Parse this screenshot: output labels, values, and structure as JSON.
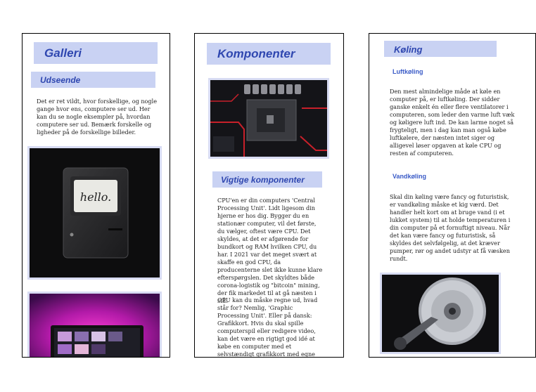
{
  "col1": {
    "title": "Galleri",
    "subtitle": "Udseende",
    "text": "Det er ret vildt, hvor forskellige, og nogle gange hvor ens, computere ser ud. Her kan du se nogle eksempler på, hvordan computere ser ud. Bemærk forskelle og ligheder på de forskellige billeder.",
    "image1_text": "hello."
  },
  "col2": {
    "title": "Komponenter",
    "subtitle": "Vigtige komponenter",
    "para1": "CPU'en er din computers 'Central Processing Unit'. Lidt ligesom din hjerne er hos dig. Bygger du en stationær computer, vil det første, du vælger, oftest være CPU. Det skyldes, at det er afgørende for bundkort og RAM hvilken CPU, du har. I 2021 var det meget svært at skaffe en god CPU, da producenterne slet ikke kunne klare efterspørgslen. Det skyldtes både corona-logistik og \"bitcoin\" mining, der fik markedet til at gå næsten i stå.",
    "para2": "GPU kan du måske regne ud, hvad står for? Nemlig, 'Graphic Processing Unit'. Eller på dansk: Grafikkort. Hvis du skal spille computerspil eller redigere video, kan det være en rigtigt god idé at købe en computer med et selvstændigt grafikkort med egne dedikerede RAM. Det er store kræfter"
  },
  "col3": {
    "title": "Køling",
    "sub1": "Luftkøling",
    "para1": "Den mest almindelige måde at køle en computer på, er luftkøling. Der sidder ganske enkelt én eller flere ventilatorer i computeren, som leder den varme luft væk og køligere luft ind. De kan larme noget så frygteligt, men i dag kan man også købe luftkølere, der næsten intet siger og alligevel løser opgaven at køle CPU og resten af computeren.",
    "sub2": "Vandkøling",
    "para2": "Skal din køling være fancy og futuristisk, er vandkøling måske et kig værd. Det handler helt kort om at bruge vand (i et lukket system) til at holde temperaturen i din computer på et fornuftigt niveau. Når det kan være fancy og futuristisk, så skyldes det selvfølgelig, at det kræver pumper, rør og andet udstyr at få væsken rundt."
  },
  "colors": {
    "heading_bg": "#c9d2f3",
    "heading_text": "#2f47b0",
    "subheading_text": "#3a5bc7"
  }
}
